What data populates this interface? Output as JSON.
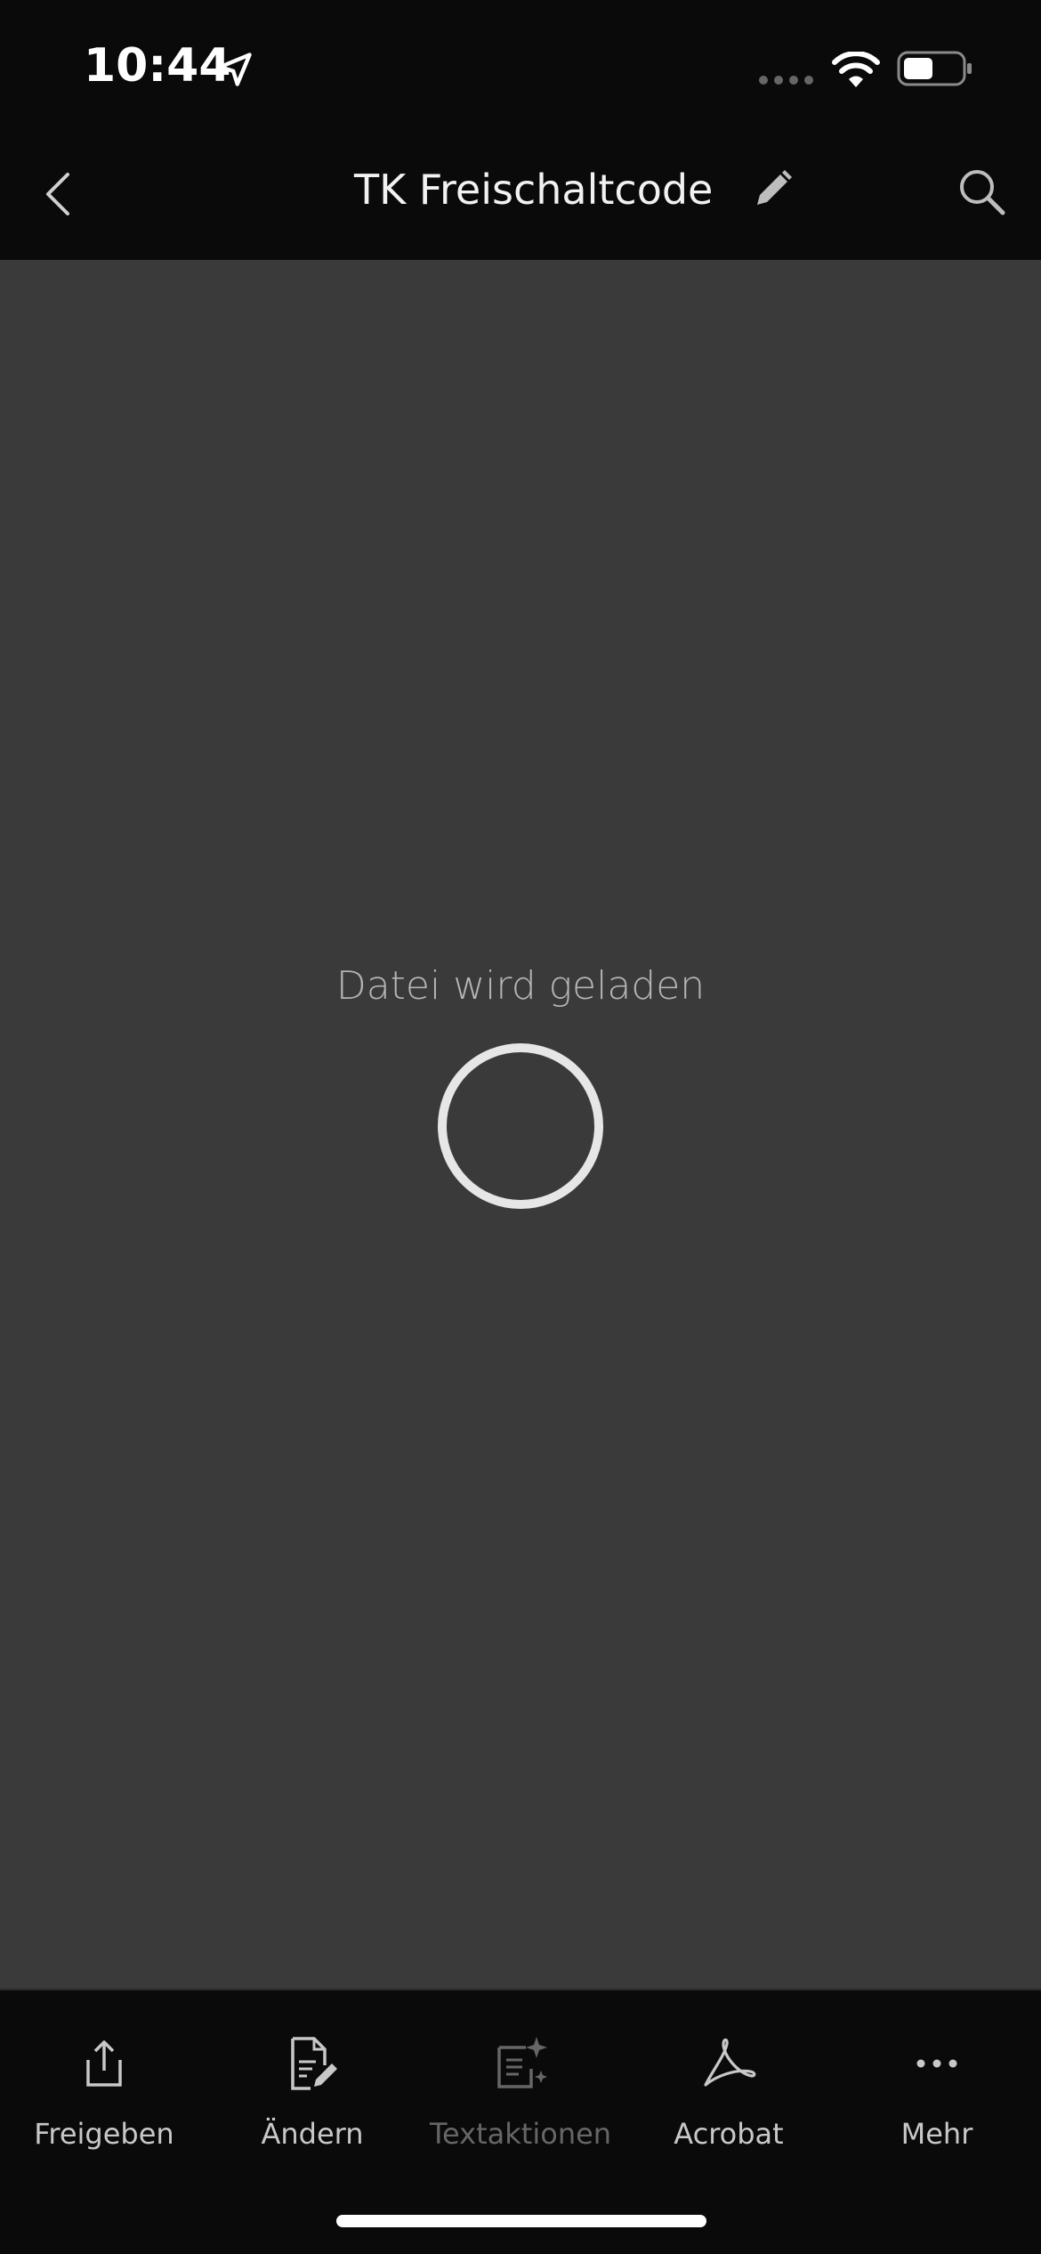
{
  "status_bar": {
    "time": "10:44"
  },
  "nav": {
    "title": "TK Freischaltcode"
  },
  "content": {
    "loading_text": "Datei wird geladen"
  },
  "toolbar": {
    "items": [
      {
        "label": "Freigeben",
        "icon": "share-icon",
        "enabled": true
      },
      {
        "label": "Ändern",
        "icon": "edit-document-icon",
        "enabled": true
      },
      {
        "label": "Textaktionen",
        "icon": "text-actions-icon",
        "enabled": false
      },
      {
        "label": "Acrobat",
        "icon": "acrobat-icon",
        "enabled": true
      },
      {
        "label": "Mehr",
        "icon": "more-icon",
        "enabled": true
      }
    ]
  },
  "colors": {
    "bar_background": "#0a0a0a",
    "content_background": "#3a3a3a",
    "icon_color": "#c8c8c8",
    "disabled_color": "#666666"
  }
}
